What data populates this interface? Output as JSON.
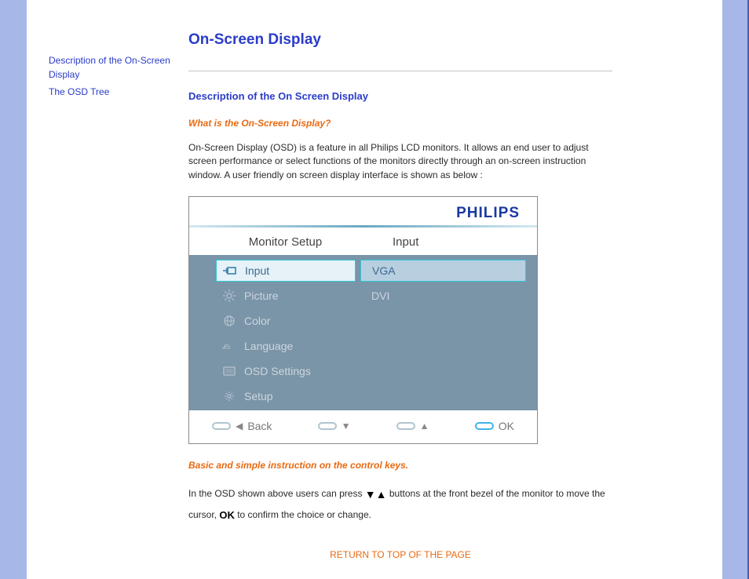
{
  "sidebar": {
    "link1": "Description of the On-Screen Display",
    "link2": "The OSD Tree"
  },
  "title": "On-Screen Display",
  "section": {
    "heading": "Description of the On Screen Display",
    "q": "What is the On-Screen Display?",
    "para": "On-Screen Display (OSD) is a feature in all Philips LCD monitors. It allows an end user to adjust screen performance or select functions of the monitors directly through an on-screen instruction window. A user friendly on screen display interface is shown as below :",
    "instr_head": "Basic and simple instruction on the control keys.",
    "instr_p1": "In the OSD shown above users can press",
    "instr_p2": "buttons at the front bezel of the monitor to move the cursor,",
    "instr_p3": "to confirm the choice or change."
  },
  "osd": {
    "brand": "PHILIPS",
    "header_left": "Monitor Setup",
    "header_right": "Input",
    "menu": {
      "input": "Input",
      "picture": "Picture",
      "color": "Color",
      "language": "Language",
      "osd_settings": "OSD Settings",
      "setup": "Setup"
    },
    "options": {
      "vga": "VGA",
      "dvi": "DVI"
    },
    "footer": {
      "back": "Back",
      "ok": "OK"
    }
  },
  "return_link": "RETURN TO TOP OF THE PAGE",
  "ok_glyph": "OK"
}
